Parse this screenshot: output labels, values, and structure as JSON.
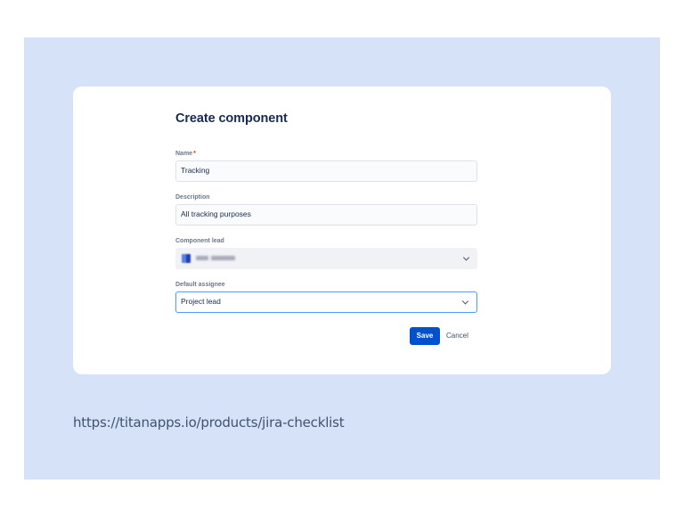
{
  "dialog": {
    "title": "Create component",
    "fields": {
      "name": {
        "label": "Name",
        "required_marker": "*",
        "value": "Tracking"
      },
      "description": {
        "label": "Description",
        "value": "All tracking purposes"
      },
      "component_lead": {
        "label": "Component lead",
        "value_obscured": true,
        "icon": "chevron-down-icon"
      },
      "default_assignee": {
        "label": "Default assignee",
        "value": "Project lead",
        "icon": "chevron-down-icon"
      }
    },
    "actions": {
      "save_label": "Save",
      "cancel_label": "Cancel"
    }
  },
  "footer": {
    "url_text": "https://titanapps.io/products/jira-checklist"
  },
  "colors": {
    "background_panel": "#d5e2f7",
    "primary_button": "#0052cc",
    "focus_border": "#4c9aff",
    "required": "#de350b"
  }
}
